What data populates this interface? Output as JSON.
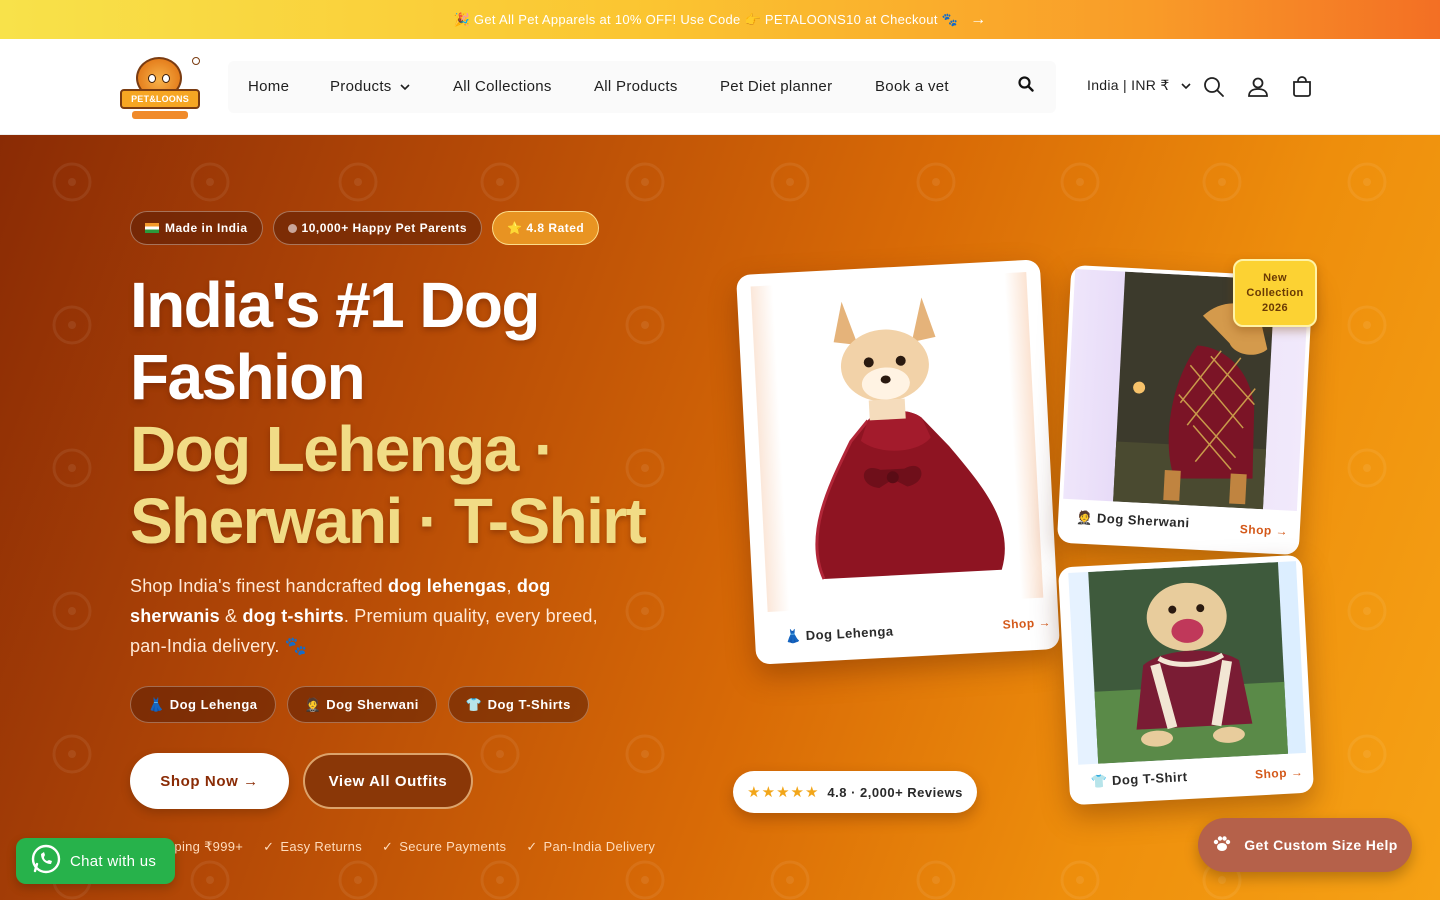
{
  "announcement": {
    "text": "🎉 Get All Pet Apparels at 10% OFF! Use Code 👉 PETALOONS10 at Checkout 🐾",
    "arrow": "→"
  },
  "header": {
    "logo_text": "PET&LOONS",
    "nav": [
      {
        "label": "Home"
      },
      {
        "label": "Products",
        "has_dropdown": true
      },
      {
        "label": "All Collections"
      },
      {
        "label": "All Products"
      },
      {
        "label": "Pet Diet planner"
      },
      {
        "label": "Book a vet"
      }
    ],
    "country_selector": "India | INR ₹",
    "icons": [
      "search-icon",
      "account-icon",
      "cart-icon"
    ]
  },
  "hero": {
    "badges": [
      "Made in India",
      "10,000+ Happy Pet Parents",
      "⭐ 4.8 Rated"
    ],
    "headline": {
      "line1": "India's #1 Dog",
      "line2": "Fashion",
      "line3": "Dog Lehenga ·",
      "line4": "Sherwani · T-Shirt"
    },
    "subtext": {
      "part1": "Shop India's finest handcrafted ",
      "b1": "dog lehengas",
      "part2": ", ",
      "b2": "dog sherwanis",
      "part3": " & ",
      "b3": "dog t-shirts",
      "part4": ". Premium quality, every breed, pan-India delivery. 🐾"
    },
    "category_pills": [
      {
        "emoji": "👗",
        "label": "Dog Lehenga"
      },
      {
        "emoji": "🤵",
        "label": "Dog Sherwani"
      },
      {
        "emoji": "👕",
        "label": "Dog T-Shirts"
      }
    ],
    "primary_button": "Shop Now →",
    "secondary_button": "View All Outfits",
    "trust_items": [
      "Shipping ₹999+",
      "Easy Returns",
      "Secure Payments",
      "Pan-India Delivery"
    ]
  },
  "cards": [
    {
      "emoji": "👗",
      "label": "Dog Lehenga",
      "shop": "Shop →"
    },
    {
      "emoji": "🤵",
      "label": "Dog Sherwani",
      "shop": "Shop →"
    },
    {
      "emoji": "👕",
      "label": "Dog T-Shirt",
      "shop": "Shop →"
    }
  ],
  "new_tag": {
    "line1": "New",
    "line2": "Collection",
    "line3": "2026"
  },
  "reviews": {
    "stars": "★★★★★",
    "text": "4.8 · 2,000+ Reviews"
  },
  "whatsapp": {
    "label": "Chat with us"
  },
  "custom_help": {
    "label": "Get Custom Size Help"
  },
  "colors": {
    "hero_dark": "#8a2b05",
    "hero_light": "#f6a215",
    "accent_gold": "#f1dc86",
    "whatsapp_green": "#27b24b",
    "help_button": "#b5614a"
  }
}
